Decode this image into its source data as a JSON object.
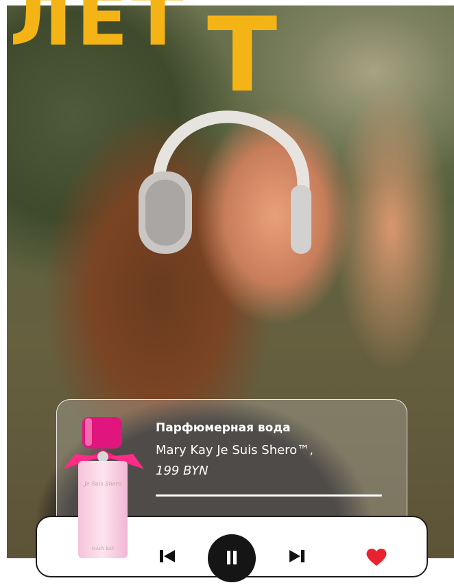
{
  "headline": {
    "letters": "ЛЕТ",
    "big_t": "Т",
    "color": "#f4b416"
  },
  "product": {
    "title": "Парфюмерная вода",
    "name": "Mary Kay Je Suis Shero™,",
    "price": "199 BYN",
    "bottle_label": "Je Suis Shero",
    "bottle_brand": "MARY KAY"
  },
  "player": {
    "progress": 1.0,
    "controls": {
      "prev_icon": "skip-previous-icon",
      "play_icon": "pause-icon",
      "next_icon": "skip-next-icon",
      "like_icon": "heart-icon"
    },
    "like_color": "#e8232f"
  }
}
